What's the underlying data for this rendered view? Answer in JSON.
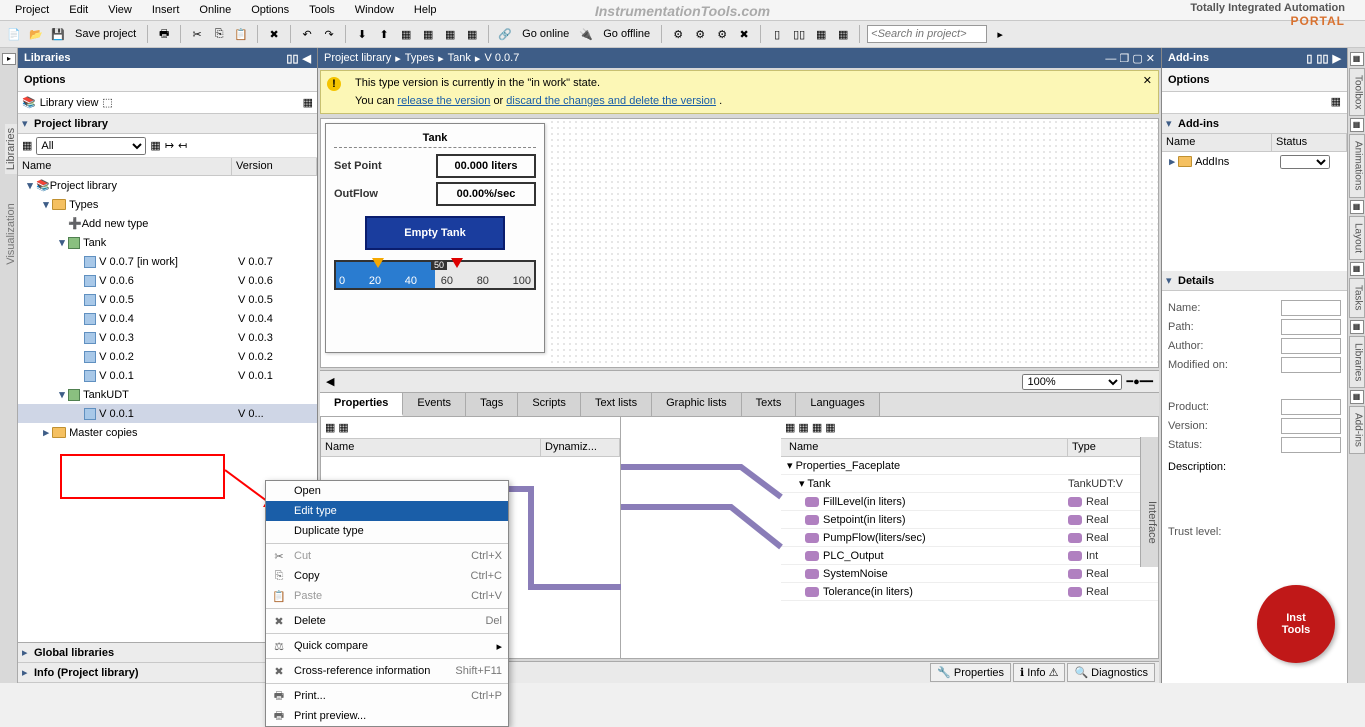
{
  "menubar": [
    "Project",
    "Edit",
    "View",
    "Insert",
    "Online",
    "Options",
    "Tools",
    "Window",
    "Help"
  ],
  "branding_top": "Totally Integrated Automation",
  "branding_bottom": "PORTAL",
  "center_logo": "InstrumentationTools.com",
  "toolbar": {
    "save": "Save project",
    "go_online": "Go online",
    "go_offline": "Go offline",
    "search_placeholder": "<Search in project>"
  },
  "left_tabs": {
    "visualization": "Visualization",
    "libraries": "Libraries"
  },
  "libraries": {
    "title": "Libraries",
    "options": "Options",
    "libview": "Library view",
    "project_library": "Project library",
    "filter": "All",
    "cols": {
      "name": "Name",
      "version": "Version"
    },
    "tree": {
      "root": "Project library",
      "types": "Types",
      "add_new": "Add new type",
      "tank": "Tank",
      "versions": [
        {
          "name": "V 0.0.7 [in work]",
          "ver": "V 0.0.7"
        },
        {
          "name": "V 0.0.6",
          "ver": "V 0.0.6"
        },
        {
          "name": "V 0.0.5",
          "ver": "V 0.0.5"
        },
        {
          "name": "V 0.0.4",
          "ver": "V 0.0.4"
        },
        {
          "name": "V 0.0.3",
          "ver": "V 0.0.3"
        },
        {
          "name": "V 0.0.2",
          "ver": "V 0.0.2"
        },
        {
          "name": "V 0.0.1",
          "ver": "V 0.0.1"
        }
      ],
      "tankudt": "TankUDT",
      "tankudt_ver": {
        "name": "V 0.0.1",
        "ver": ""
      },
      "master_copies": "Master copies"
    },
    "global": "Global libraries",
    "info": "Info (Project library)"
  },
  "breadcrumb": [
    "Project library",
    "Types",
    "Tank",
    "V 0.0.7"
  ],
  "notice": {
    "line1": "This type version is currently in the \"in work\" state.",
    "you_can": "You can ",
    "release": "release the version",
    "or": " or ",
    "discard": "discard the changes and delete the version",
    "dot": " ."
  },
  "faceplate": {
    "title": "Tank",
    "setpoint_label": "Set Point",
    "setpoint_val": "00.000 liters",
    "outflow_label": "OutFlow",
    "outflow_val": "00.00%/sec",
    "button": "Empty Tank",
    "ticks": [
      "0",
      "20",
      "40",
      "60",
      "80",
      "100"
    ],
    "mid": "50"
  },
  "zoom": "100%",
  "tabs": [
    "Properties",
    "Events",
    "Tags",
    "Scripts",
    "Text lists",
    "Graphic lists",
    "Texts",
    "Languages"
  ],
  "props": {
    "left_cols": {
      "name": "Name",
      "dyn": "Dynamiz..."
    },
    "right_cols": {
      "name": "Name",
      "type": "Type"
    },
    "right_root": "Properties_Faceplate",
    "tank_row": {
      "name": "Tank",
      "type": "TankUDT:V"
    },
    "rows": [
      {
        "name": "FillLevel(in liters)",
        "type": "Real"
      },
      {
        "name": "Setpoint(in liters)",
        "type": "Real"
      },
      {
        "name": "PumpFlow(liters/sec)",
        "type": "Real"
      },
      {
        "name": "PLC_Output",
        "type": "Int"
      },
      {
        "name": "SystemNoise",
        "type": "Real"
      },
      {
        "name": "Tolerance(in liters)",
        "type": "Real"
      }
    ],
    "interface": "Interface"
  },
  "bottom_tabs": {
    "properties": "Properties",
    "info": "Info",
    "diag": "Diagnostics"
  },
  "addins": {
    "title": "Add-ins",
    "options": "Options",
    "addins_section": "Add-ins",
    "cols": {
      "name": "Name",
      "status": "Status"
    },
    "row": "AddIns",
    "details": "Details",
    "fields": [
      "Name:",
      "Path:",
      "Author:",
      "Modified on:",
      "Product:",
      "Version:",
      "Status:"
    ],
    "description": "Description:",
    "trust": "Trust level:"
  },
  "right_tabs": [
    "Toolbox",
    "Animations",
    "Layout",
    "Tasks",
    "Libraries",
    "Add-ins"
  ],
  "context_menu": [
    {
      "label": "Open",
      "type": "item"
    },
    {
      "label": "Edit type",
      "type": "sel"
    },
    {
      "label": "Duplicate type",
      "type": "item"
    },
    {
      "type": "sep"
    },
    {
      "label": "Cut",
      "shortcut": "Ctrl+X",
      "icon": "✂",
      "type": "disabled"
    },
    {
      "label": "Copy",
      "shortcut": "Ctrl+C",
      "icon": "⎘",
      "type": "item"
    },
    {
      "label": "Paste",
      "shortcut": "Ctrl+V",
      "icon": "📋",
      "type": "disabled"
    },
    {
      "type": "sep"
    },
    {
      "label": "Delete",
      "shortcut": "Del",
      "icon": "✖",
      "type": "item"
    },
    {
      "type": "sep"
    },
    {
      "label": "Quick compare",
      "icon": "⚖",
      "type": "sub"
    },
    {
      "type": "sep"
    },
    {
      "label": "Cross-reference information",
      "shortcut": "Shift+F11",
      "icon": "✖",
      "type": "item"
    },
    {
      "type": "sep"
    },
    {
      "label": "Print...",
      "shortcut": "Ctrl+P",
      "icon": "🖶",
      "type": "item"
    },
    {
      "label": "Print preview...",
      "icon": "🖶",
      "type": "item"
    }
  ],
  "inst_logo": {
    "l1": "Inst",
    "l2": "Tools"
  }
}
